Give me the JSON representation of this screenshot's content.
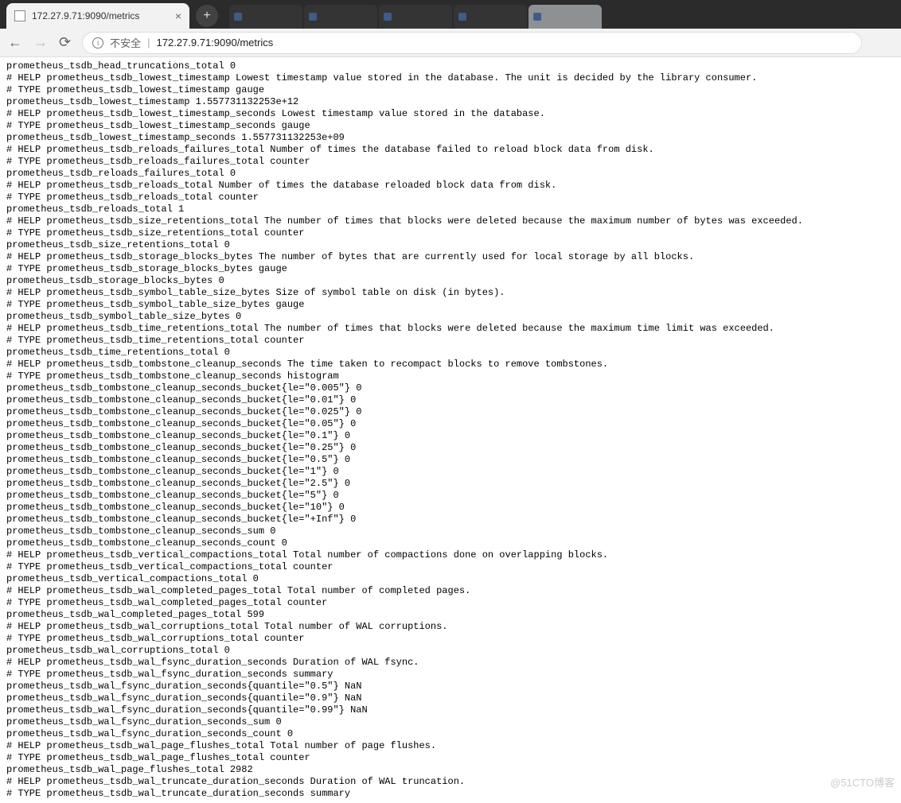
{
  "tab": {
    "title": "172.27.9.71:9090/metrics"
  },
  "newtab_label": "+",
  "addr": {
    "warn": "不安全",
    "sep": "|",
    "url": "172.27.9.71:9090/metrics",
    "info_glyph": "i"
  },
  "watermark": "@51CTO博客",
  "metrics": [
    "prometheus_tsdb_head_truncations_total 0",
    "# HELP prometheus_tsdb_lowest_timestamp Lowest timestamp value stored in the database. The unit is decided by the library consumer.",
    "# TYPE prometheus_tsdb_lowest_timestamp gauge",
    "prometheus_tsdb_lowest_timestamp 1.557731132253e+12",
    "# HELP prometheus_tsdb_lowest_timestamp_seconds Lowest timestamp value stored in the database.",
    "# TYPE prometheus_tsdb_lowest_timestamp_seconds gauge",
    "prometheus_tsdb_lowest_timestamp_seconds 1.557731132253e+09",
    "# HELP prometheus_tsdb_reloads_failures_total Number of times the database failed to reload block data from disk.",
    "# TYPE prometheus_tsdb_reloads_failures_total counter",
    "prometheus_tsdb_reloads_failures_total 0",
    "# HELP prometheus_tsdb_reloads_total Number of times the database reloaded block data from disk.",
    "# TYPE prometheus_tsdb_reloads_total counter",
    "prometheus_tsdb_reloads_total 1",
    "# HELP prometheus_tsdb_size_retentions_total The number of times that blocks were deleted because the maximum number of bytes was exceeded.",
    "# TYPE prometheus_tsdb_size_retentions_total counter",
    "prometheus_tsdb_size_retentions_total 0",
    "# HELP prometheus_tsdb_storage_blocks_bytes The number of bytes that are currently used for local storage by all blocks.",
    "# TYPE prometheus_tsdb_storage_blocks_bytes gauge",
    "prometheus_tsdb_storage_blocks_bytes 0",
    "# HELP prometheus_tsdb_symbol_table_size_bytes Size of symbol table on disk (in bytes).",
    "# TYPE prometheus_tsdb_symbol_table_size_bytes gauge",
    "prometheus_tsdb_symbol_table_size_bytes 0",
    "# HELP prometheus_tsdb_time_retentions_total The number of times that blocks were deleted because the maximum time limit was exceeded.",
    "# TYPE prometheus_tsdb_time_retentions_total counter",
    "prometheus_tsdb_time_retentions_total 0",
    "# HELP prometheus_tsdb_tombstone_cleanup_seconds The time taken to recompact blocks to remove tombstones.",
    "# TYPE prometheus_tsdb_tombstone_cleanup_seconds histogram",
    "prometheus_tsdb_tombstone_cleanup_seconds_bucket{le=\"0.005\"} 0",
    "prometheus_tsdb_tombstone_cleanup_seconds_bucket{le=\"0.01\"} 0",
    "prometheus_tsdb_tombstone_cleanup_seconds_bucket{le=\"0.025\"} 0",
    "prometheus_tsdb_tombstone_cleanup_seconds_bucket{le=\"0.05\"} 0",
    "prometheus_tsdb_tombstone_cleanup_seconds_bucket{le=\"0.1\"} 0",
    "prometheus_tsdb_tombstone_cleanup_seconds_bucket{le=\"0.25\"} 0",
    "prometheus_tsdb_tombstone_cleanup_seconds_bucket{le=\"0.5\"} 0",
    "prometheus_tsdb_tombstone_cleanup_seconds_bucket{le=\"1\"} 0",
    "prometheus_tsdb_tombstone_cleanup_seconds_bucket{le=\"2.5\"} 0",
    "prometheus_tsdb_tombstone_cleanup_seconds_bucket{le=\"5\"} 0",
    "prometheus_tsdb_tombstone_cleanup_seconds_bucket{le=\"10\"} 0",
    "prometheus_tsdb_tombstone_cleanup_seconds_bucket{le=\"+Inf\"} 0",
    "prometheus_tsdb_tombstone_cleanup_seconds_sum 0",
    "prometheus_tsdb_tombstone_cleanup_seconds_count 0",
    "# HELP prometheus_tsdb_vertical_compactions_total Total number of compactions done on overlapping blocks.",
    "# TYPE prometheus_tsdb_vertical_compactions_total counter",
    "prometheus_tsdb_vertical_compactions_total 0",
    "# HELP prometheus_tsdb_wal_completed_pages_total Total number of completed pages.",
    "# TYPE prometheus_tsdb_wal_completed_pages_total counter",
    "prometheus_tsdb_wal_completed_pages_total 599",
    "# HELP prometheus_tsdb_wal_corruptions_total Total number of WAL corruptions.",
    "# TYPE prometheus_tsdb_wal_corruptions_total counter",
    "prometheus_tsdb_wal_corruptions_total 0",
    "# HELP prometheus_tsdb_wal_fsync_duration_seconds Duration of WAL fsync.",
    "# TYPE prometheus_tsdb_wal_fsync_duration_seconds summary",
    "prometheus_tsdb_wal_fsync_duration_seconds{quantile=\"0.5\"} NaN",
    "prometheus_tsdb_wal_fsync_duration_seconds{quantile=\"0.9\"} NaN",
    "prometheus_tsdb_wal_fsync_duration_seconds{quantile=\"0.99\"} NaN",
    "prometheus_tsdb_wal_fsync_duration_seconds_sum 0",
    "prometheus_tsdb_wal_fsync_duration_seconds_count 0",
    "# HELP prometheus_tsdb_wal_page_flushes_total Total number of page flushes.",
    "# TYPE prometheus_tsdb_wal_page_flushes_total counter",
    "prometheus_tsdb_wal_page_flushes_total 2982",
    "# HELP prometheus_tsdb_wal_truncate_duration_seconds Duration of WAL truncation.",
    "# TYPE prometheus_tsdb_wal_truncate_duration_seconds summary"
  ]
}
